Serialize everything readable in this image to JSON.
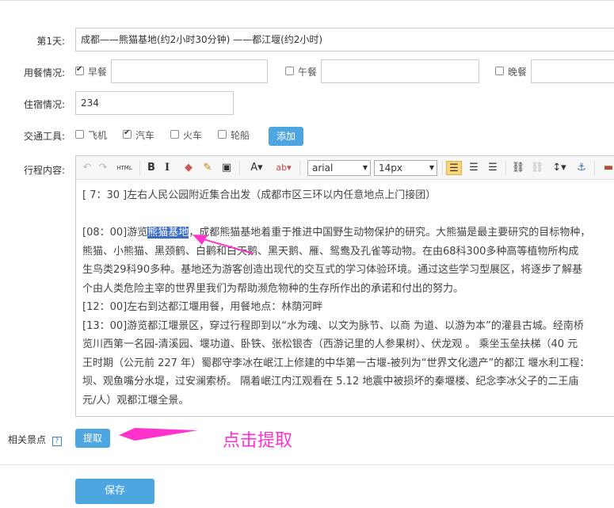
{
  "day1": {
    "label": "第1天:",
    "value": "成都——熊猫基地(约2小时30分钟) ——都江堰(约2小时)"
  },
  "meals": {
    "label": "用餐情况:",
    "breakfast": "早餐",
    "lunch": "午餐",
    "dinner": "晚餐",
    "breakfast_checked": true,
    "lunch_checked": false,
    "dinner_checked": false
  },
  "lodging": {
    "label": "住宿情况:",
    "value": "234"
  },
  "transport": {
    "label": "交通工具:",
    "options": [
      "飞机",
      "汽车",
      "火车",
      "轮船"
    ],
    "checked": [
      false,
      true,
      false,
      false
    ],
    "add": "添加"
  },
  "itinerary": {
    "label": "行程内容:",
    "toolbar": {
      "html": "HTML",
      "bold": "B",
      "italic": "I",
      "font": "arial",
      "size": "14px"
    },
    "lines": [
      "[ 7：30 ]左右人民公园附近集合出发（成都市区三环以内任意地点上门接团）",
      "",
      "[08：00]游览|熊猫基地|，成都熊猫基地着重于推进中国野生动物保护的研究。大熊猫是最主要研究的目标物种，",
      "熊猫、小熊猫、黑颈鹤、白鹳和白天鹅、黑天鹅、雁、鸳鸯及孔雀等动物。在由68科300多种高等植物所构成",
      "生鸟类29科90多种。基地还为游客创造出现代的交互式的学习体验环境。通过这些学习型展区，将逐步了解基",
      "个由人类危险主宰的世界里我们为帮助濒危物种的生存所作出的承诺和付出的努力。",
      "[12：00]左右到达都江堰用餐，用餐地点：林荫河畔",
      "[13：00]游览都江堰景区，穿过行程即到以“水为魂、以文为脉节、以商 为道、以游为本”的灌县古城。经南桥",
      "览川西第一名园-清溪园、堰功道、卧铁、张松银杏（西游记里的人参果树）、伏龙观 。 乘坐玉垒扶梯（40 元",
      "王时期（公元前 227 年）蜀郡守李冰在岷江上修建的中华第一古堰-被列为“世界文化遗产”的都江 堰水利工程：",
      "坝、观鱼嘴分水堤，过安澜索桥。 隔着岷江内江观看在 5.12 地震中被损坏的秦堰楼、纪念李冰父子的二王庙",
      "元/人）观都江堰全景。"
    ]
  },
  "related": {
    "label": "相关景点",
    "help": "?",
    "extract": "提取",
    "annotation": "点击提取"
  },
  "save": "保存",
  "colors": {
    "accent": "#4da6e0",
    "annotation": "#ff33cc",
    "highlight": "#3b6dc7"
  }
}
